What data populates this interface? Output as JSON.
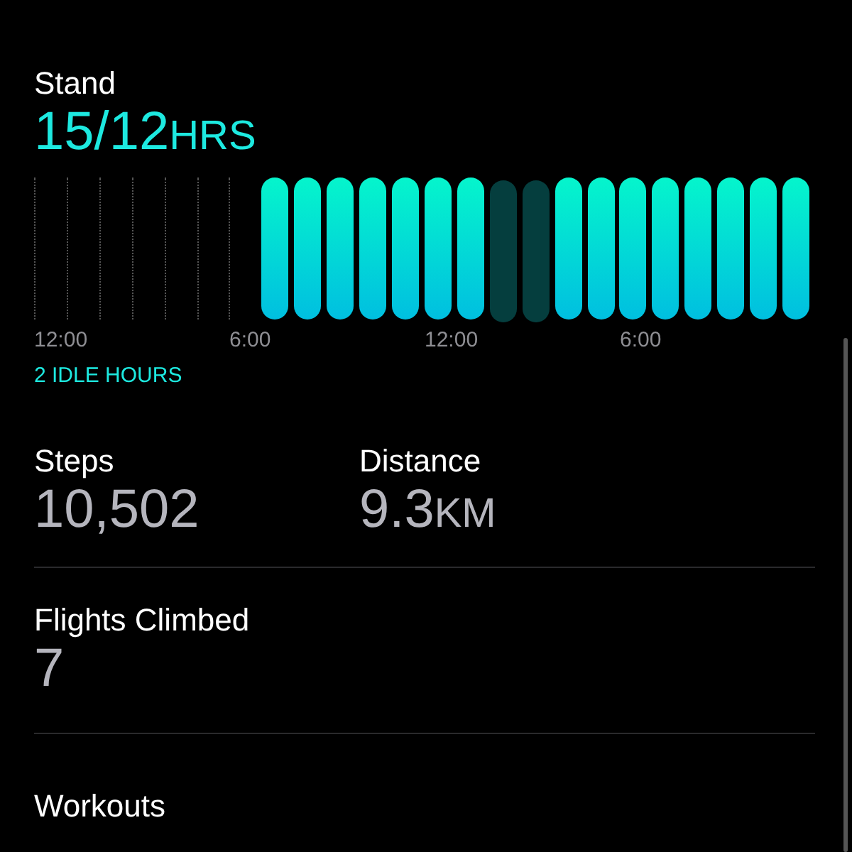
{
  "stand": {
    "label": "Stand",
    "value": "15/12",
    "unit": "HRS",
    "hours": [
      {
        "kind": "none"
      },
      {
        "kind": "none"
      },
      {
        "kind": "none"
      },
      {
        "kind": "none"
      },
      {
        "kind": "none"
      },
      {
        "kind": "none"
      },
      {
        "kind": "none"
      },
      {
        "kind": "stood"
      },
      {
        "kind": "stood"
      },
      {
        "kind": "stood"
      },
      {
        "kind": "stood"
      },
      {
        "kind": "stood"
      },
      {
        "kind": "stood"
      },
      {
        "kind": "stood"
      },
      {
        "kind": "idle"
      },
      {
        "kind": "idle"
      },
      {
        "kind": "stood"
      },
      {
        "kind": "stood"
      },
      {
        "kind": "stood"
      },
      {
        "kind": "stood"
      },
      {
        "kind": "stood"
      },
      {
        "kind": "stood"
      },
      {
        "kind": "stood"
      },
      {
        "kind": "stood"
      }
    ],
    "ticks": [
      "12:00",
      "6:00",
      "12:00",
      "6:00"
    ],
    "idle_note": "2 IDLE HOURS"
  },
  "stats": [
    {
      "label": "Steps",
      "value": "10,502"
    },
    {
      "label": "Distance",
      "value": "9.3",
      "unit": "KM"
    }
  ],
  "flights": {
    "label": "Flights Climbed",
    "value": "7"
  },
  "workouts": {
    "label": "Workouts"
  }
}
